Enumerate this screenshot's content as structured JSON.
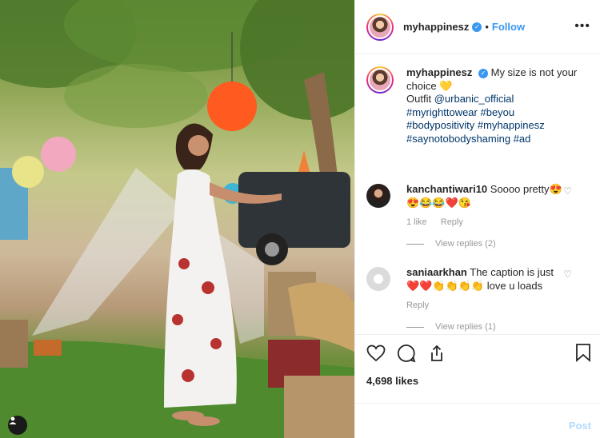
{
  "post": {
    "username": "myhappinesz",
    "verified_icon": "verified-badge",
    "separator": "•",
    "follow_label": "Follow",
    "more_label": "•••",
    "caption": {
      "username": "myhappinesz",
      "text_line1": "My size is not your choice",
      "heart_emoji": "💛",
      "outfit_label": "Outfit",
      "mention": "@urbanic_official",
      "hashtags_line1": "#myrighttowear #beyou",
      "hashtags_line2": "#bodypositivity #myhappinesz",
      "hashtags_line3": "#saynotobodyshaming #ad"
    },
    "comments": [
      {
        "username": "kanchantiwari10",
        "text": "Soooo pretty😍",
        "text_line2": "😍😂😂❤️😘",
        "likes": "1 like",
        "reply_label": "Reply",
        "view_replies": "View replies (2)"
      },
      {
        "username": "saniaarkhan",
        "text": "The caption is just",
        "text_line2": "❤️❤️👏👏👏👏 love u loads",
        "reply_label": "Reply",
        "view_replies": "View replies (1)"
      }
    ],
    "likes_count": "4,698 likes",
    "post_label": "Post"
  },
  "colors": {
    "accent": "#3897f0",
    "link": "#003569",
    "post_disabled": "#b3dbff"
  }
}
